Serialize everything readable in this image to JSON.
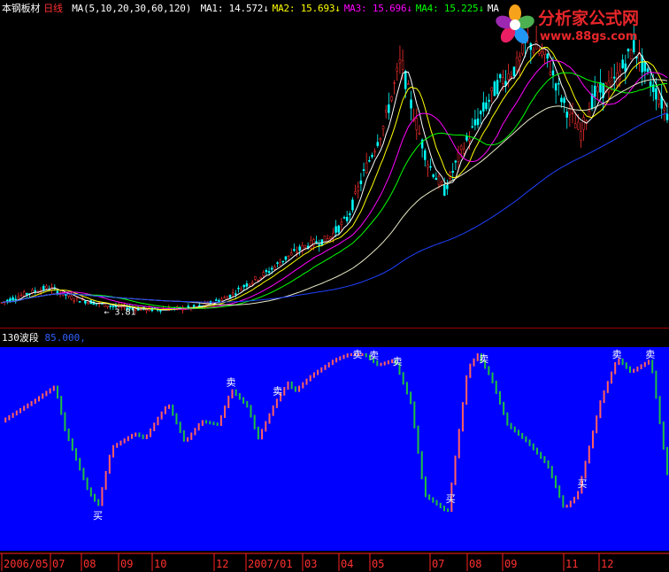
{
  "header": {
    "symbol": "本钢板材",
    "period": "日线",
    "ma_spec": "MA(5,10,20,30,60,120)",
    "ma_values": [
      {
        "label": "MA1:",
        "value": "14.572",
        "arrow": "↓",
        "color": "#ffffff"
      },
      {
        "label": "MA2:",
        "value": "15.693",
        "arrow": "↓",
        "color": "#ffff00"
      },
      {
        "label": "MA3:",
        "value": "15.696",
        "arrow": "↓",
        "color": "#ff00ff"
      },
      {
        "label": "MA4:",
        "value": "15.225",
        "arrow": "↓",
        "color": "#00ff00"
      },
      {
        "label": "MA",
        "value": "",
        "arrow": "",
        "color": "#ffffff"
      }
    ]
  },
  "indicator": {
    "name": "130波段",
    "value": "85.000,"
  },
  "logo": {
    "text": "分析家公式网",
    "url": "www.88gs.com"
  },
  "price_low_label": "3.81",
  "chart_data": [
    {
      "type": "candlestick",
      "title": "本钢板材 日线",
      "ylim": [
        3.0,
        19.0
      ],
      "series": [
        {
          "name": "MA1",
          "color": "#ffffff"
        },
        {
          "name": "MA2",
          "color": "#ffff00"
        },
        {
          "name": "MA3",
          "color": "#ff00ff"
        },
        {
          "name": "MA4",
          "color": "#00ff00"
        }
      ],
      "trend": {
        "x": [
          0,
          0.03,
          0.07,
          0.11,
          0.17,
          0.22,
          0.27,
          0.3,
          0.34,
          0.37,
          0.4,
          0.43,
          0.46,
          0.49,
          0.52,
          0.545,
          0.575,
          0.6,
          0.615,
          0.64,
          0.665,
          0.69,
          0.72,
          0.745,
          0.775,
          0.79,
          0.82,
          0.845,
          0.87,
          0.89,
          0.92,
          0.95,
          0.97,
          1.0
        ],
        "y": [
          4.2,
          4.6,
          5.0,
          4.4,
          4.0,
          3.85,
          3.9,
          4.0,
          4.5,
          5.2,
          5.8,
          6.6,
          7.2,
          7.5,
          8.6,
          11.0,
          13.5,
          16.8,
          14.5,
          11.5,
          10.0,
          12.0,
          14.0,
          15.5,
          16.5,
          17.8,
          16.8,
          14.5,
          13.0,
          15.0,
          15.6,
          17.5,
          16.0,
          14.0
        ]
      }
    },
    {
      "type": "line",
      "title": "130波段",
      "ylim": [
        0,
        100
      ],
      "x": [
        0,
        0.05,
        0.08,
        0.095,
        0.13,
        0.145,
        0.165,
        0.2,
        0.215,
        0.235,
        0.25,
        0.275,
        0.3,
        0.325,
        0.345,
        0.37,
        0.385,
        0.41,
        0.43,
        0.44,
        0.465,
        0.5,
        0.52,
        0.545,
        0.565,
        0.59,
        0.615,
        0.635,
        0.67,
        0.7,
        0.715,
        0.735,
        0.76,
        0.79,
        0.82,
        0.845,
        0.865,
        0.9,
        0.925,
        0.945,
        0.975,
        1.0
      ],
      "y": [
        60,
        72,
        80,
        55,
        20,
        12,
        45,
        53,
        50,
        62,
        70,
        48,
        60,
        58,
        78,
        68,
        50,
        70,
        82,
        77,
        86,
        95,
        98,
        98,
        92,
        95,
        70,
        18,
        8,
        90,
        98,
        85,
        58,
        48,
        35,
        10,
        18,
        72,
        96,
        88,
        95,
        30
      ],
      "annotations": [
        {
          "text": "卖",
          "x": 0.345
        },
        {
          "text": "卖",
          "x": 0.415
        },
        {
          "text": "卖",
          "x": 0.535
        },
        {
          "text": "卖",
          "x": 0.56
        },
        {
          "text": "卖",
          "x": 0.595
        },
        {
          "text": "卖",
          "x": 0.725
        },
        {
          "text": "卖",
          "x": 0.925
        },
        {
          "text": "卖",
          "x": 0.975
        },
        {
          "text": "买",
          "x": 0.145
        },
        {
          "text": "买",
          "x": 0.675
        },
        {
          "text": "买",
          "x": 0.873
        }
      ]
    }
  ],
  "time_axis": {
    "labels": [
      "2006/05",
      "07",
      "08",
      "09",
      "10",
      "12",
      "2007/01",
      "03",
      "04",
      "05",
      "07",
      "08",
      "09",
      "11",
      "12"
    ]
  }
}
